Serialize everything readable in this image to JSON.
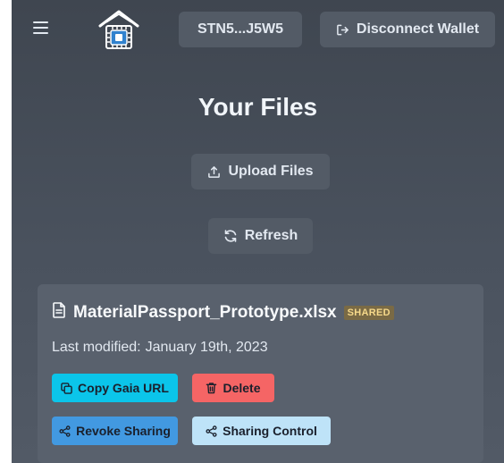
{
  "header": {
    "menu_icon": "hamburger-menu-icon",
    "logo_icon": "house-chip-logo-icon",
    "wallet_address": "STN5...J5W5",
    "disconnect_label": "Disconnect Wallet",
    "disconnect_icon": "logout-icon"
  },
  "main": {
    "title": "Your Files",
    "upload_label": "Upload Files",
    "upload_icon": "upload-icon",
    "refresh_label": "Refresh",
    "refresh_icon": "refresh-icon"
  },
  "files": [
    {
      "file_icon": "file-document-icon",
      "name": "MaterialPassport_Prototype.xlsx",
      "badge": "SHARED",
      "modified_label": "Last modified:",
      "modified_date": "January 19th, 2023",
      "actions": {
        "copy_label": "Copy Gaia URL",
        "copy_icon": "copy-icon",
        "delete_label": "Delete",
        "delete_icon": "trash-icon",
        "revoke_label": "Revoke Sharing",
        "revoke_icon": "share-icon",
        "sharing_label": "Sharing Control",
        "sharing_icon": "share-icon"
      }
    }
  ],
  "colors": {
    "background": "#4a525e",
    "button_dark": "#535b66",
    "card": "#59616d",
    "cyan": "#0bc5ea",
    "red": "#f56565",
    "blue": "#4299e1",
    "light_blue": "#bee3f8",
    "badge": "#7a6a45"
  }
}
